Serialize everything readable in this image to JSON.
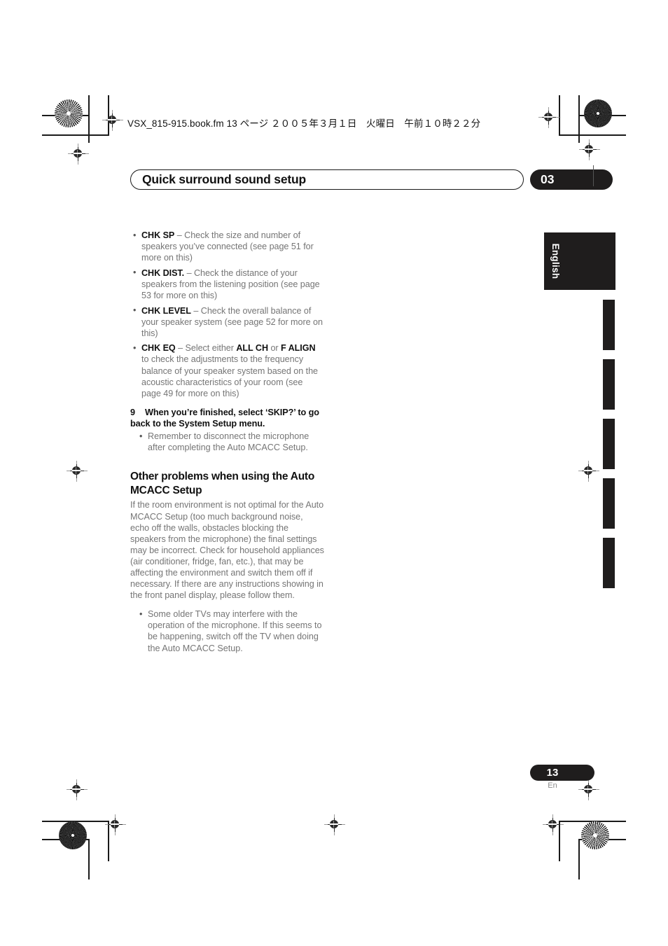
{
  "header": {
    "slug": "VSX_815-915.book.fm  13 ページ  ２００５年３月１日　火曜日　午前１０時２２分"
  },
  "chapter": {
    "title": "Quick surround sound setup",
    "number": "03"
  },
  "side_tab": {
    "language": "English"
  },
  "body": {
    "bullets": [
      {
        "term": "CHK SP",
        "text": " – Check the size and number of speakers you’ve connected (see page 51 for more on this)"
      },
      {
        "term": "CHK DIST.",
        "text": " – Check the distance of your speakers from the listening position (see page 53 for more on this)"
      },
      {
        "term": "CHK LEVEL",
        "text": " – Check the overall balance of your speaker system (see page 52 for more on this)"
      }
    ],
    "chk_eq": {
      "term": "CHK EQ",
      "part1": " – Select either ",
      "bold1": "ALL CH",
      "part2": " or ",
      "bold2": "F ALIGN",
      "part3": " to check the adjustments to the frequency balance of your speaker system based on the acoustic characteristics of your room (see page 49 for more on this)"
    },
    "step": {
      "number": "9",
      "text": "When you’re finished, select ‘SKIP?’ to go back to the System Setup menu."
    },
    "step_note": "Remember to disconnect the microphone after completing the Auto MCACC Setup.",
    "section_heading": "Other problems when using the Auto MCACC Setup",
    "paragraph": "If the room environment is not optimal for the Auto MCACC Setup (too much background noise, echo off the walls, obstacles blocking the speakers from the microphone) the final settings may be incorrect. Check for household appliances (air conditioner, fridge, fan, etc.), that may be affecting the environment and switch them off if necessary. If there are any instructions showing in the front panel display, please follow them.",
    "final_note": "Some older TVs may interfere with the operation of the microphone. If this seems to be happening, switch off the TV when doing the Auto MCACC Setup."
  },
  "footer": {
    "page_number": "13",
    "page_language": "En"
  },
  "colors": {
    "ink_black": "#1f1d1d",
    "body_gray": "#757575",
    "heading_black": "#111111"
  }
}
